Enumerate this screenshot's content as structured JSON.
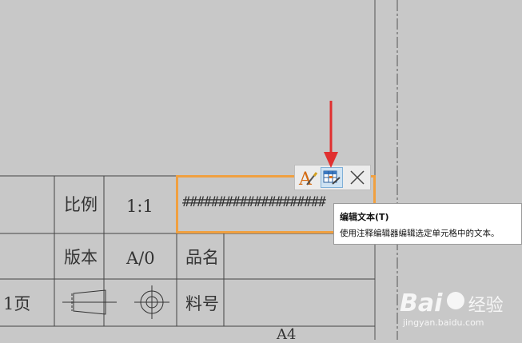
{
  "title_block": {
    "row1": {
      "label": "比例",
      "value": "1:1",
      "text_cell_value": "####################"
    },
    "row2": {
      "label": "版本",
      "value": "A/0",
      "field": "品名"
    },
    "row3": {
      "page_label": "1页",
      "field": "料号"
    },
    "below_text": "A4"
  },
  "mini_toolbar": {
    "buttons": [
      {
        "name": "text-style",
        "icon": "A-brush-icon"
      },
      {
        "name": "edit-text",
        "icon": "table-edit-icon",
        "active": true
      },
      {
        "name": "close",
        "icon": "close-icon"
      }
    ]
  },
  "tooltip": {
    "title": "编辑文本(T)",
    "description": "使用注释编辑器编辑选定单元格中的文本。"
  },
  "watermark": {
    "brand": "Bai",
    "brand_suffix": "经验",
    "url": "jingyan.baidu.com"
  },
  "colors": {
    "canvas": "#c8c8c8",
    "highlight": "#f0a040",
    "arrow": "#e03030",
    "lines": "#333333"
  }
}
